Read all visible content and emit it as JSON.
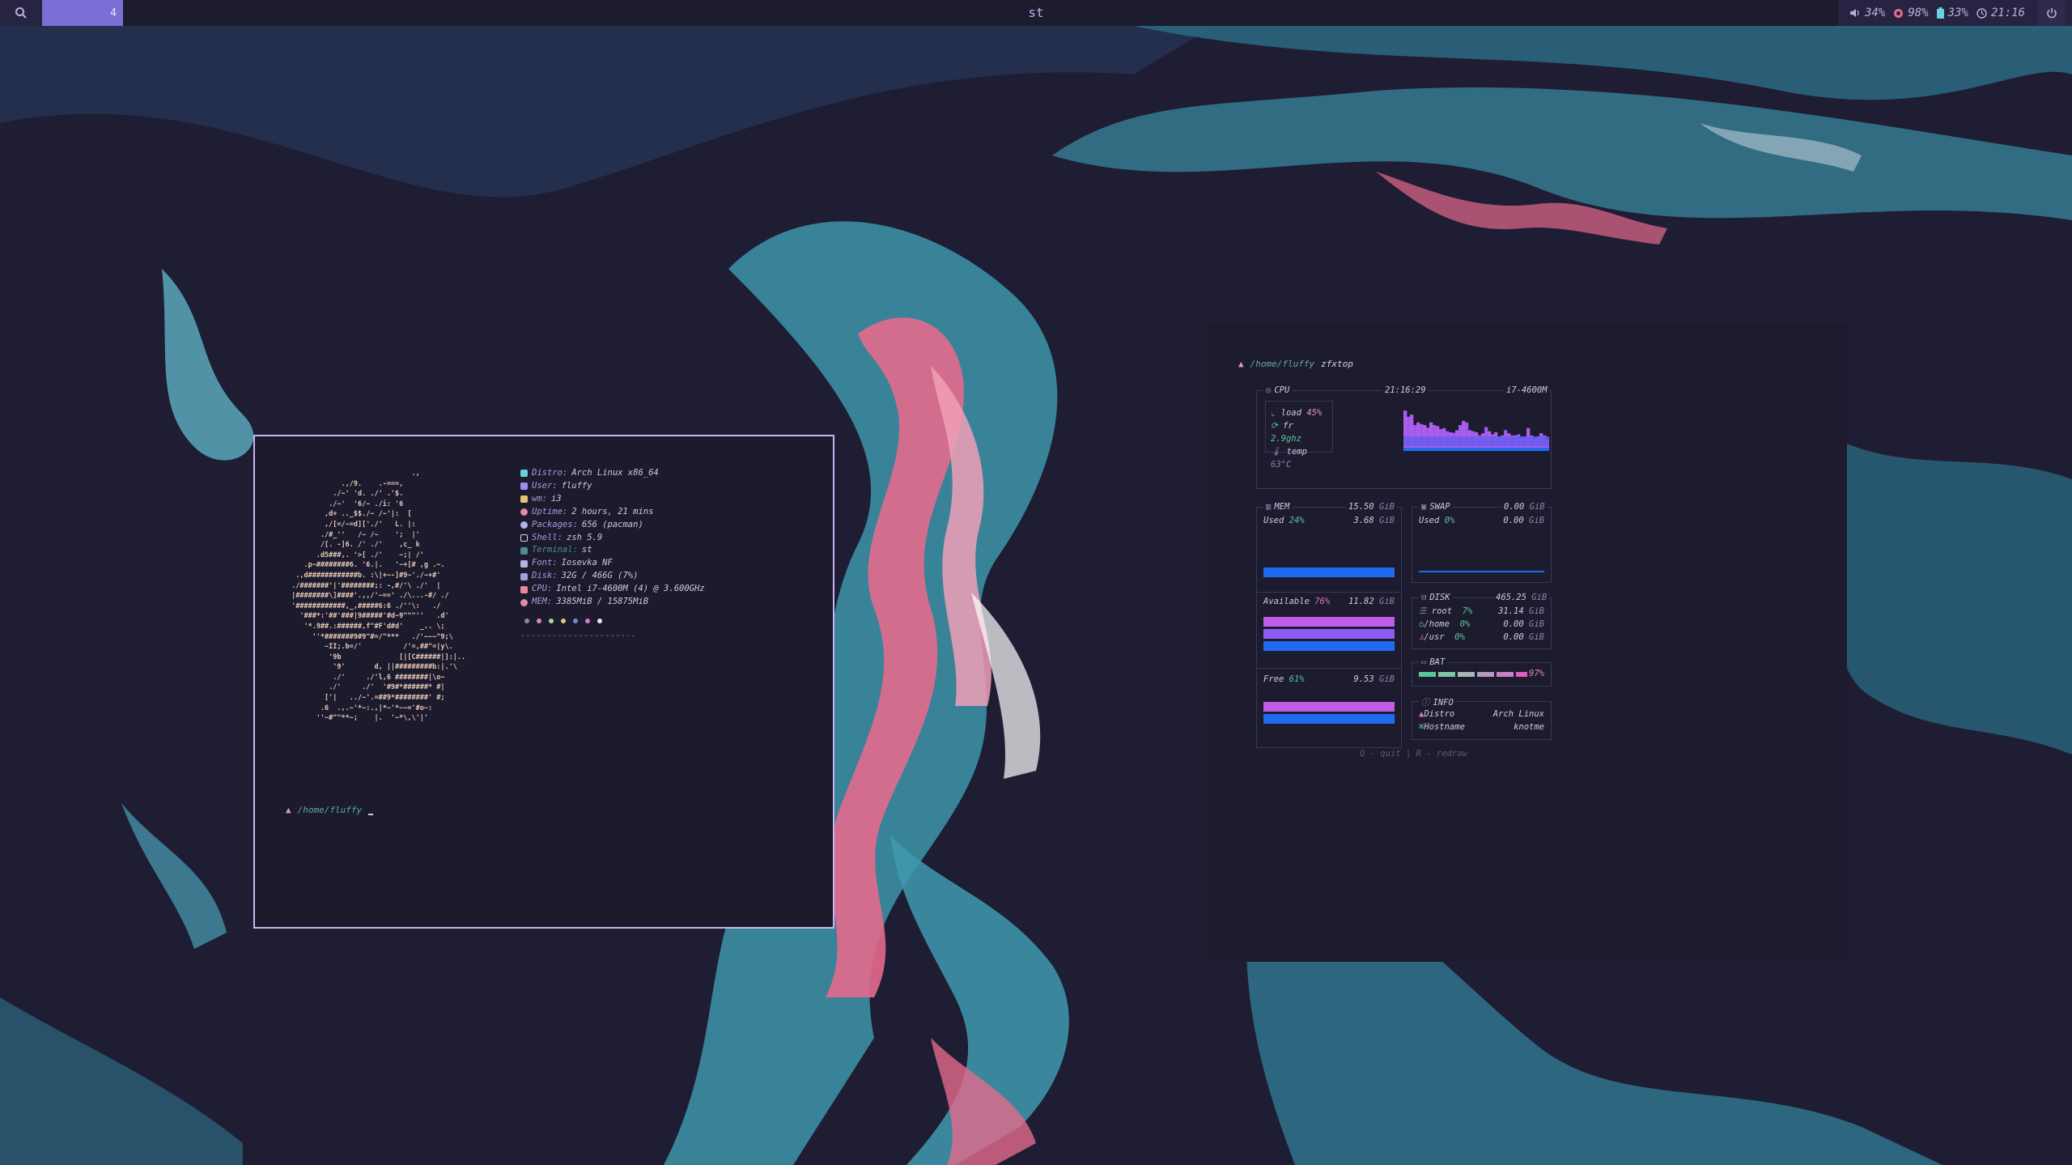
{
  "topbar": {
    "workspace": "4",
    "window_title": "st",
    "volume": "34%",
    "brightness": "98%",
    "battery": "33%",
    "clock": "21:16"
  },
  "neofetch": {
    "rows": [
      {
        "key": "Distro:",
        "value": "Arch Linux x86_64",
        "color": "#6ad0d6"
      },
      {
        "key": "User:",
        "value": "fluffy",
        "color": "#9d8cf0"
      },
      {
        "key": "wm:",
        "value": "i3",
        "color": "#e0c47a"
      },
      {
        "key": "Uptime:",
        "value": "2 hours, 21 mins",
        "color": "#e58aa0"
      },
      {
        "key": "Packages:",
        "value": "656 (pacman)",
        "color": "#b6b0e8"
      },
      {
        "key": "Shell:",
        "value": "zsh 5.9",
        "color": "#d9d4f4"
      },
      {
        "key": "Terminal:",
        "value": "st",
        "color": "#4f8b94"
      },
      {
        "key": "Font:",
        "value": "Iosevka NF",
        "color": "#b6b0e8"
      },
      {
        "key": "Disk:",
        "value": "32G / 466G (7%)",
        "color": "#a49ee0"
      },
      {
        "key": "CPU:",
        "value": "Intel i7-4600M (4) @ 3.600GHz",
        "color": "#e58aa0"
      },
      {
        "key": "MEM:",
        "value": "3385MiB / 15875MiB",
        "color": "#e58aa0"
      }
    ],
    "palette": [
      "#8a85b5",
      "#e58aa0",
      "#a8d8a0",
      "#e0c47a",
      "#5f8fd6",
      "#d879c8",
      "#e8e4ff"
    ],
    "separator": "----------------------"
  },
  "term1_prompt": {
    "path": "/home/fluffy"
  },
  "zfxtop": {
    "prompt_path": "/home/fluffy",
    "prompt_cmd": "zfxtop",
    "cpu": {
      "title": "CPU",
      "time": "21:16:29",
      "model": "i7-4600M",
      "load_label": "load",
      "load": "45%",
      "freq_label": "fr",
      "freq": "2.9ghz",
      "temp_label": "temp",
      "temp": "63°C",
      "history": [
        0.78,
        0.66,
        0.7,
        0.5,
        0.55,
        0.52,
        0.5,
        0.45,
        0.55,
        0.5,
        0.48,
        0.42,
        0.44,
        0.38,
        0.36,
        0.35,
        0.4,
        0.5,
        0.58,
        0.55,
        0.4,
        0.38,
        0.36,
        0.3,
        0.34,
        0.46,
        0.38,
        0.32,
        0.36,
        0.28,
        0.3,
        0.4,
        0.34,
        0.3,
        0.3,
        0.32,
        0.26,
        0.28,
        0.44,
        0.3,
        0.24,
        0.28,
        0.34,
        0.3,
        0.22
      ]
    },
    "mem": {
      "title": "MEM",
      "total": "15.50",
      "unit": "GiB",
      "used_label": "Used",
      "used_pct": "24%",
      "used": "3.68",
      "avail_label": "Available",
      "avail_pct": "76%",
      "avail": "11.82",
      "free_label": "Free",
      "free_pct": "61%",
      "free": "9.53"
    },
    "swap": {
      "title": "SWAP",
      "total": "0.00",
      "unit": "GiB",
      "used_label": "Used",
      "used_pct": "0%",
      "used": "0.00"
    },
    "disk": {
      "title": "DISK",
      "total": "465.25",
      "unit": "GiB",
      "rows": [
        {
          "name": "root",
          "pct": "7%",
          "value": "31.14"
        },
        {
          "name": "/home",
          "pct": "0%",
          "value": "0.00"
        },
        {
          "name": "/usr",
          "pct": "0%",
          "value": "0.00"
        }
      ]
    },
    "bat": {
      "title": "BAT",
      "pct": "97%"
    },
    "info": {
      "title": "INFO",
      "rows": [
        {
          "key": "Distro",
          "value": "Arch Linux"
        },
        {
          "key": "Hostname",
          "value": "knotme"
        }
      ]
    },
    "help": {
      "q": "Q",
      "quit": "- quit",
      "sep": "|",
      "r": "R",
      "redraw": "- redraw"
    }
  }
}
